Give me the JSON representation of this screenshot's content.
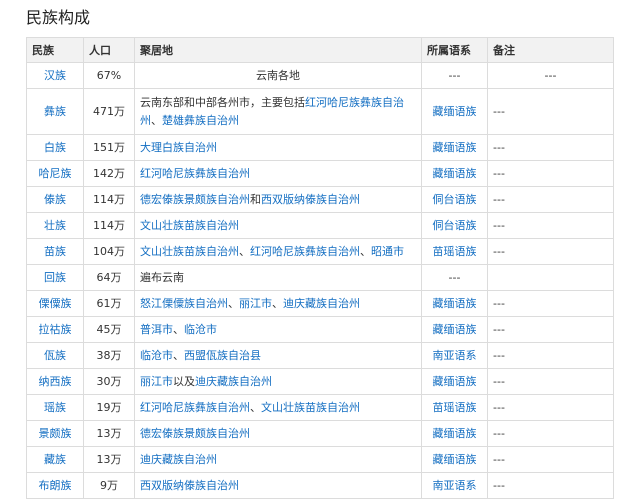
{
  "heading": "民族构成",
  "table": {
    "headers": [
      "民族",
      "人口",
      "聚居地",
      "所属语系",
      "备注"
    ],
    "rows": [
      {
        "name": "汉族",
        "pop": "67%",
        "area": [
          {
            "t": "云南各地",
            "link": false
          }
        ],
        "family": "---",
        "family_link": false,
        "note": "---",
        "center": true
      },
      {
        "name": "彝族",
        "pop": "471万",
        "area": [
          {
            "t": "云南东部和中部各州市，主要包括",
            "link": false
          },
          {
            "t": "红河哈尼族彝族自治州",
            "link": true
          },
          {
            "t": "、",
            "link": false
          },
          {
            "t": "楚雄彝族自治州",
            "link": true
          }
        ],
        "family": "藏缅语族",
        "family_link": true,
        "note": "---",
        "tall": true
      },
      {
        "name": "白族",
        "pop": "151万",
        "area": [
          {
            "t": "大理白族自治州",
            "link": true
          }
        ],
        "family": "藏缅语族",
        "family_link": true,
        "note": "---"
      },
      {
        "name": "哈尼族",
        "pop": "142万",
        "area": [
          {
            "t": "红河哈尼族彝族自治州",
            "link": true
          }
        ],
        "family": "藏缅语族",
        "family_link": true,
        "note": "---"
      },
      {
        "name": "傣族",
        "pop": "114万",
        "area": [
          {
            "t": "德宏傣族景颇族自治州",
            "link": true
          },
          {
            "t": "和",
            "link": false
          },
          {
            "t": "西双版纳傣族自治州",
            "link": true
          }
        ],
        "family": "侗台语族",
        "family_link": true,
        "note": "---"
      },
      {
        "name": "壮族",
        "pop": "114万",
        "area": [
          {
            "t": "文山壮族苗族自治州",
            "link": true
          }
        ],
        "family": "侗台语族",
        "family_link": true,
        "note": "---"
      },
      {
        "name": "苗族",
        "pop": "104万",
        "area": [
          {
            "t": "文山壮族苗族自治州",
            "link": true
          },
          {
            "t": "、",
            "link": false
          },
          {
            "t": "红河哈尼族彝族自治州",
            "link": true
          },
          {
            "t": "、",
            "link": false
          },
          {
            "t": "昭通市",
            "link": true
          }
        ],
        "family": "苗瑶语族",
        "family_link": true,
        "note": "---"
      },
      {
        "name": "回族",
        "pop": "64万",
        "area": [
          {
            "t": "遍布云南",
            "link": false
          }
        ],
        "family": "---",
        "family_link": false,
        "note": ""
      },
      {
        "name": "傈僳族",
        "pop": "61万",
        "area": [
          {
            "t": "怒江傈僳族自治州",
            "link": true
          },
          {
            "t": "、",
            "link": false
          },
          {
            "t": "丽江市",
            "link": true
          },
          {
            "t": "、",
            "link": false
          },
          {
            "t": "迪庆藏族自治州",
            "link": true
          }
        ],
        "family": "藏缅语族",
        "family_link": true,
        "note": "---"
      },
      {
        "name": "拉祜族",
        "pop": "45万",
        "area": [
          {
            "t": "普洱市",
            "link": true
          },
          {
            "t": "、",
            "link": false
          },
          {
            "t": "临沧市",
            "link": true
          }
        ],
        "family": "藏缅语族",
        "family_link": true,
        "note": "---"
      },
      {
        "name": "佤族",
        "pop": "38万",
        "area": [
          {
            "t": "临沧市",
            "link": true
          },
          {
            "t": "、",
            "link": false
          },
          {
            "t": "西盟佤族自治县",
            "link": true
          }
        ],
        "family": "南亚语系",
        "family_link": true,
        "note": "---"
      },
      {
        "name": "纳西族",
        "pop": "30万",
        "area": [
          {
            "t": "丽江市",
            "link": true
          },
          {
            "t": "以及",
            "link": false
          },
          {
            "t": "迪庆藏族自治州",
            "link": true
          }
        ],
        "family": "藏缅语族",
        "family_link": true,
        "note": "---"
      },
      {
        "name": "瑶族",
        "pop": "19万",
        "area": [
          {
            "t": "红河哈尼族彝族自治州",
            "link": true
          },
          {
            "t": "、",
            "link": false
          },
          {
            "t": "文山壮族苗族自治州",
            "link": true
          }
        ],
        "family": "苗瑶语族",
        "family_link": true,
        "note": "---"
      },
      {
        "name": "景颇族",
        "pop": "13万",
        "area": [
          {
            "t": "德宏傣族景颇族自治州",
            "link": true
          }
        ],
        "family": "藏缅语族",
        "family_link": true,
        "note": "---"
      },
      {
        "name": "藏族",
        "pop": "13万",
        "area": [
          {
            "t": "迪庆藏族自治州",
            "link": true
          }
        ],
        "family": "藏缅语族",
        "family_link": true,
        "note": "---"
      },
      {
        "name": "布朗族",
        "pop": "9万",
        "area": [
          {
            "t": "西双版纳傣族自治州",
            "link": true
          }
        ],
        "family": "南亚语系",
        "family_link": true,
        "note": "---"
      }
    ]
  },
  "colors": {
    "link": "#136ec2",
    "header_bg": "#f2f2f2",
    "border": "#dcdcdc"
  }
}
